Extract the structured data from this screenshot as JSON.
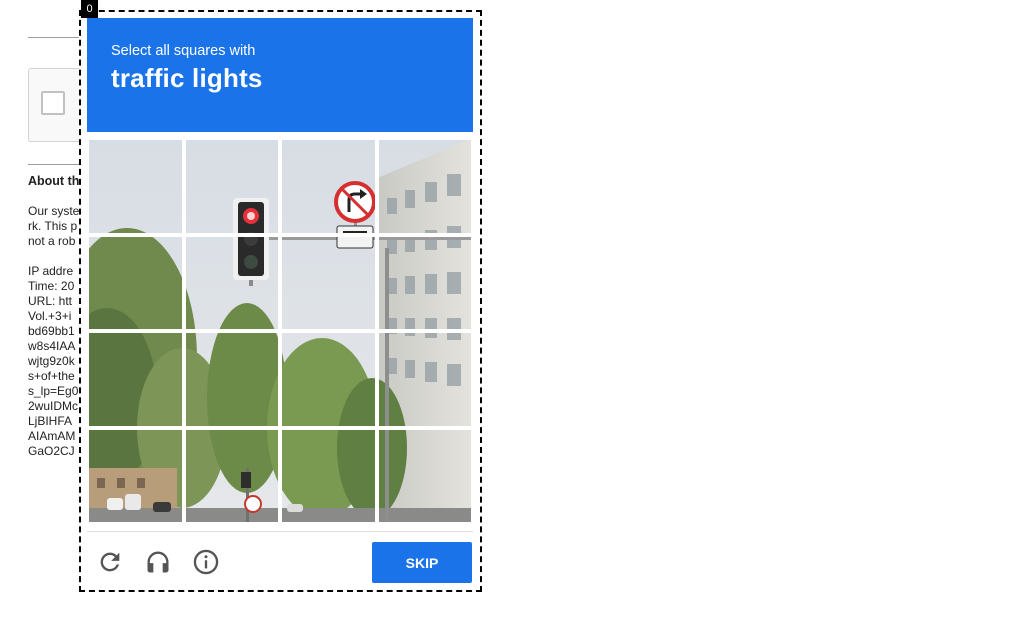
{
  "frame_index": "0",
  "background_page": {
    "heading": "About th",
    "lines": [
      "Our syste",
      "rk. This p",
      "not a rob",
      "",
      "IP addre",
      "Time: 20",
      "URL: htt",
      "Vol.+3+i",
      "bd69bb1",
      "w8s4IAA",
      "wjtg9z0k",
      "s+of+the",
      "s_lp=Eg0",
      "2wuIDMc",
      "LjBIHFA",
      "AIAmAM",
      "GaO2CJ"
    ]
  },
  "challenge": {
    "instruction": "Select all squares with",
    "target": "traffic lights",
    "grid": {
      "rows": 4,
      "cols": 4
    },
    "buttons": {
      "reload_icon": "reload-icon",
      "audio_icon": "headphones-icon",
      "info_icon": "info-icon",
      "skip_label": "SKIP"
    },
    "colors": {
      "accent": "#1a73e8",
      "header_text": "#ffffff"
    }
  }
}
